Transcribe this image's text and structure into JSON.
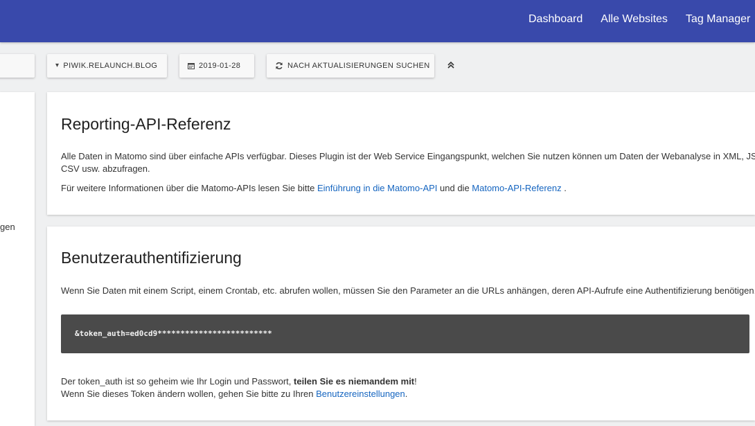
{
  "topnav": {
    "items": [
      "Dashboard",
      "Alle Websites",
      "Tag Manager"
    ]
  },
  "toolbar": {
    "site_label": "PIWIK.RELAUNCH.BLOG",
    "date_label": "2019-01-28",
    "update_label": "NACH AKTUALISIERUNGEN SUCHEN"
  },
  "leftpanel": {
    "fragment": "gen"
  },
  "card1": {
    "title": "Reporting-API-Referenz",
    "para1_line1": "Alle Daten in Matomo sind über einfache APIs verfügbar. Dieses Plugin ist der Web Service Eingangspunkt, welchen Sie nutzen können um Daten der Webanalyse in XML, JSON, PHP,",
    "para1_line2": "CSV usw. abzufragen.",
    "para2_prefix": "Für weitere Informationen über die Matomo-APIs lesen Sie bitte ",
    "link1": "Einführung in die Matomo-API",
    "para2_middle": " und die ",
    "link2": "Matomo-API-Referenz",
    "para2_suffix": " ."
  },
  "card2": {
    "title": "Benutzerauthentifizierung",
    "para1": "Wenn Sie Daten mit einem Script, einem Crontab, etc. abrufen wollen, müssen Sie den Parameter an die URLs anhängen, deren API-Aufrufe eine Authentifizierung benötigen.",
    "token_code": "&token_auth=ed0cd9*************************",
    "para2_prefix": "Der token_auth ist so geheim wie Ihr Login und Passwort, ",
    "para2_bold": "teilen Sie es niemandem mit",
    "para2_suffix": "!",
    "para3_prefix": "Wenn Sie dieses Token ändern wollen, gehen Sie bitte zu Ihren ",
    "link_settings": "Benutzereinstellungen",
    "para3_suffix": "."
  },
  "colors": {
    "header": "#3949ab",
    "link": "#1565c0",
    "code_bg": "#4a4a4a",
    "page_bg": "#eff0f1"
  },
  "icons": {
    "site": "caret-down-icon",
    "date": "calendar-icon",
    "update": "refresh-icon",
    "collapse": "chevron-double-up-icon"
  }
}
